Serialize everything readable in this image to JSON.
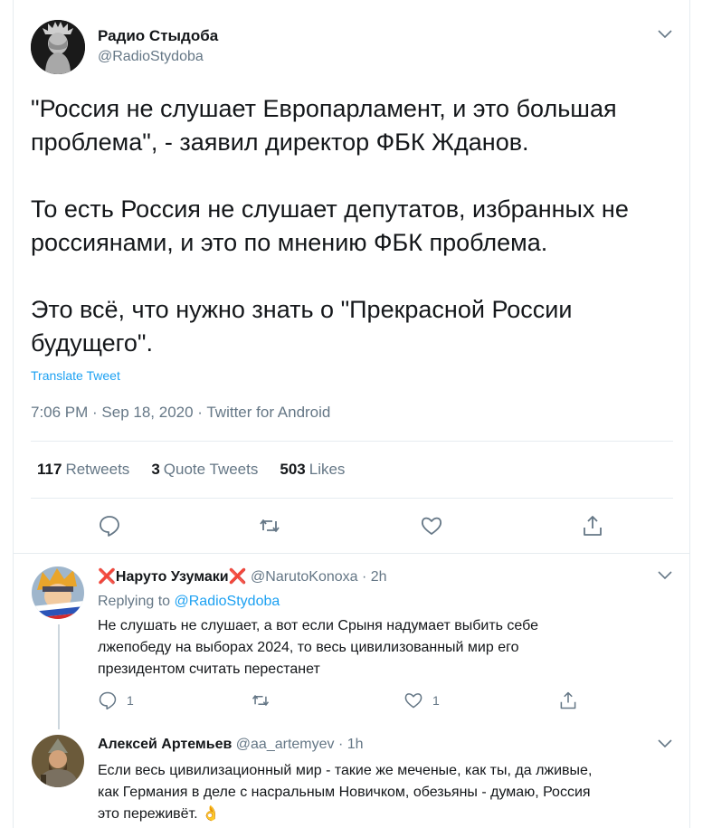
{
  "main_tweet": {
    "author_name": "Радио Стыдоба",
    "author_handle": "@RadioStydoba",
    "text": "\"Россия не слушает Европарламент, и это большая\nпроблема\", - заявил директор ФБК Жданов.\n\nТо есть Россия не слушает депутатов, избранных не\nроссиянами, и это по мнению ФБК проблема.\n\nЭто всё, что нужно знать о \"Прекрасной России\nбудущего\".",
    "translate_label": "Translate Tweet",
    "meta": "7:06 PM · Sep 18, 2020 · Twitter for Android",
    "stats": {
      "retweets_count": "117",
      "retweets_label": "Retweets",
      "quotes_count": "3",
      "quotes_label": "Quote Tweets",
      "likes_count": "503",
      "likes_label": "Likes"
    },
    "actions": [
      "reply-icon",
      "retweet-icon",
      "like-icon",
      "share-icon"
    ]
  },
  "replies": [
    {
      "cross_left": "❌",
      "name": "Наруто Узумаки",
      "cross_right": "❌",
      "handle": "@NarutoKonoxa",
      "time": "· 2h",
      "replying_prefix": "Replying to",
      "replying_to": "@RadioStydoba",
      "text_lines": [
        "Не слушать не слушает, а вот если Срыня надумает выбить себе",
        "лжепобеду на выборах 2024, то весь цивилизованный мир его",
        "президентом считать перестанет"
      ],
      "reply_count": "1",
      "like_count": "1"
    },
    {
      "name": "Алексей Артемьев",
      "handle": "@aa_artemyev",
      "time": "· 1h",
      "text_lines": [
        "Если весь цивилизационный мир - такие же меченые, как ты, да лживые,",
        "как Германия в деле с насральным Новичком, обезьяны - думаю, Россия",
        "это переживёт."
      ],
      "emoji": "👌"
    }
  ],
  "colors": {
    "text": "#14171a",
    "secondary": "#657786",
    "link": "#1da1f2",
    "border": "#e6ecf0"
  }
}
